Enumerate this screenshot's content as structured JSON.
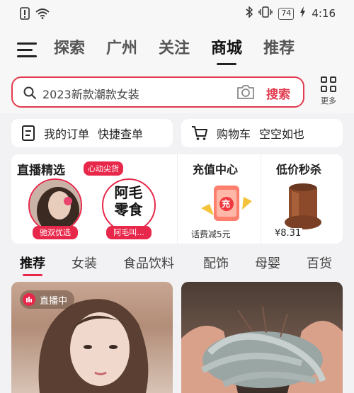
{
  "status_bar": {
    "time": "4:16",
    "battery": "74"
  },
  "header": {
    "tabs": [
      {
        "label": "探索"
      },
      {
        "label": "广州"
      },
      {
        "label": "关注"
      },
      {
        "label": "商城"
      },
      {
        "label": "推荐"
      }
    ],
    "active_tab": "商城"
  },
  "search": {
    "placeholder": "2023新款潮款女装",
    "button": "搜索",
    "more_label": "更多"
  },
  "shortcuts": {
    "orders": {
      "label": "我的订单",
      "sub": "快捷查单"
    },
    "cart": {
      "label": "购物车",
      "sub": "空空如也"
    }
  },
  "promo": {
    "live": {
      "title": "直播精选",
      "badge": "心动尖货",
      "hosts": [
        {
          "tag": "驰双优选"
        },
        {
          "tag": "阿毛叫...",
          "avatar_text": [
            "阿毛",
            "零食"
          ]
        }
      ]
    },
    "recharge": {
      "title": "充值中心",
      "icon_char": "充",
      "sub": "话费减5元"
    },
    "flash": {
      "title": "低价秒杀",
      "price": "¥8.31"
    }
  },
  "categories": [
    {
      "label": "推荐"
    },
    {
      "label": "女装"
    },
    {
      "label": "食品饮料"
    },
    {
      "label": "配饰"
    },
    {
      "label": "母婴"
    },
    {
      "label": "百货"
    }
  ],
  "feed": {
    "left": {
      "badge": "直播中"
    }
  },
  "colors": {
    "accent": "#e8284a",
    "search_border": "#e23a4e"
  }
}
